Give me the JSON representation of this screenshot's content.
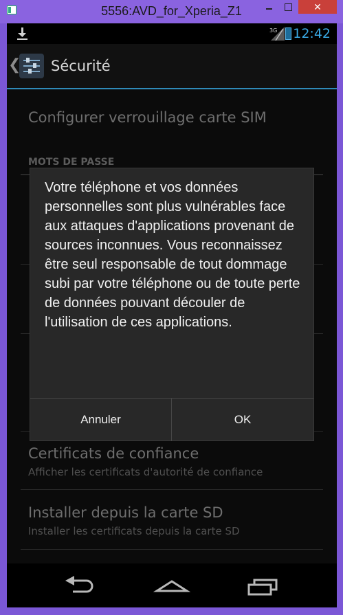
{
  "window": {
    "title": "5556:AVD_for_Xperia_Z1",
    "close_glyph": "✕"
  },
  "statusbar": {
    "time": "12:42",
    "network": "3G"
  },
  "actionbar": {
    "title": "Sécurité",
    "back_glyph": "❮"
  },
  "settings": {
    "sim_lock_title": "Configurer verrouillage carte SIM",
    "passwords_section": "MOTS DE PASSE",
    "trusted_certs_title": "Certificats de confiance",
    "trusted_certs_sub": "Afficher les certificats d'autorité de confiance",
    "install_sd_title": "Installer depuis la carte SD",
    "install_sd_sub": "Installer les certificats depuis la carte SD"
  },
  "dialog": {
    "message": "Votre téléphone et vos données personnelles sont plus vulnérables face aux attaques d'applications provenant de sources inconnues. Vous reconnaissez être seul responsable de tout dommage subi par votre téléphone ou de toute perte de données pouvant découler de l'utilisation de ces applications.",
    "cancel_label": "Annuler",
    "ok_label": "OK"
  },
  "colors": {
    "accent": "#3aa9e5",
    "dialog_bg": "#282828",
    "window_frame": "#8a63e0",
    "close_button": "#c9403a"
  },
  "icons": {
    "download": "download-icon",
    "signal": "signal-icon",
    "battery": "battery-icon",
    "settings_app": "security-settings-icon",
    "nav_back": "back-icon",
    "nav_home": "home-icon",
    "nav_recents": "recents-icon"
  }
}
